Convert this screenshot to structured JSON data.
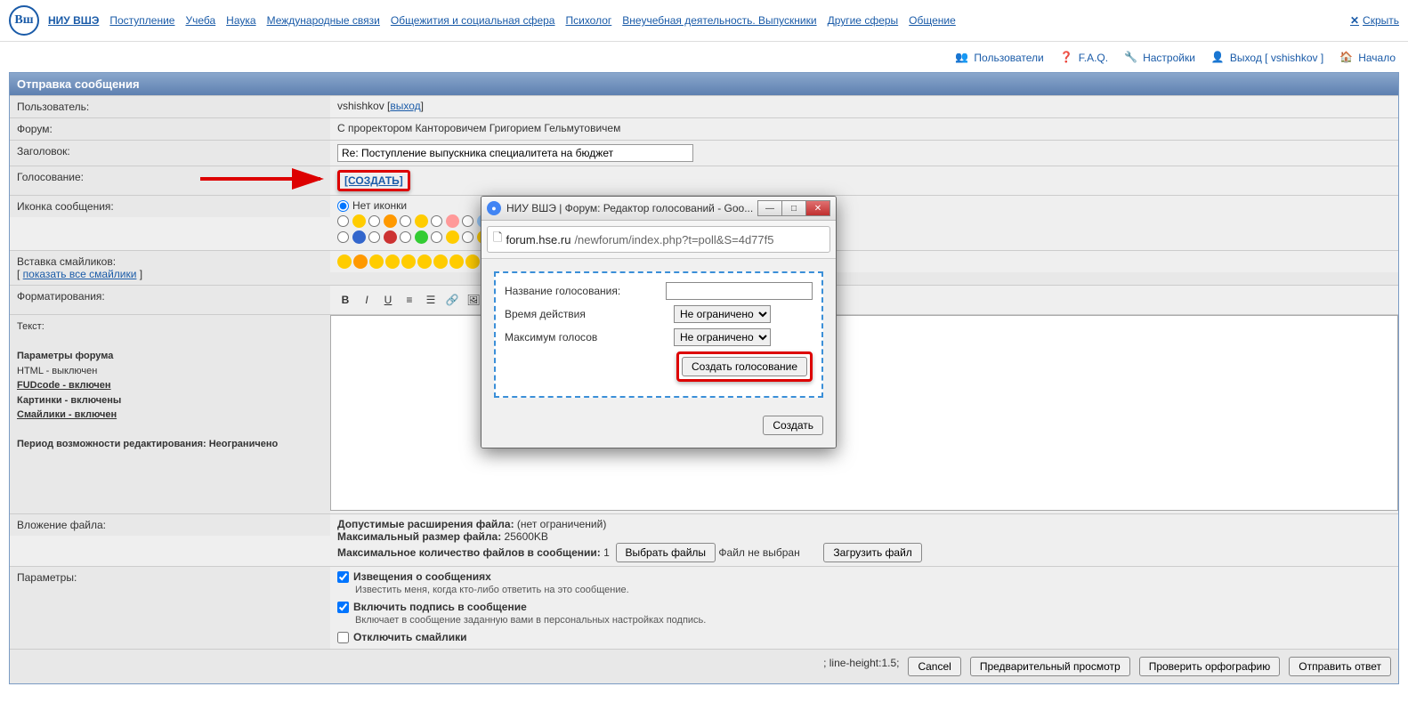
{
  "top_nav": {
    "brand": "НИУ ВШЭ",
    "links": [
      "Поступление",
      "Учеба",
      "Наука",
      "Международные связи",
      "Общежития и социальная сфера",
      "Психолог",
      "Внеучебная деятельность. Выпускники",
      "Другие сферы",
      "Общение"
    ],
    "hide": "Скрыть"
  },
  "util_nav": {
    "users": "Пользователи",
    "faq": "F.A.Q.",
    "settings": "Настройки",
    "logout": "Выход [ vshishkov ]",
    "home": "Начало"
  },
  "section_title": "Отправка сообщения",
  "form": {
    "user_label": "Пользователь:",
    "user_value": "vshishkov",
    "logout_link": "выход",
    "forum_label": "Форум:",
    "forum_value": "С проректором Канторовичем Григорием Гельмутовичем",
    "subject_label": "Заголовок:",
    "subject_value": "Re: Поступление выпускника специалитета на бюджет",
    "poll_label": "Голосование:",
    "poll_create": "[СОЗДАТЬ]",
    "icon_label": "Иконка сообщения:",
    "no_icon": "Нет иконки",
    "smileys_label": "Вставка смайликов:",
    "show_all_smileys": "показать все смайлики",
    "formatting_label": "Форматирования:",
    "text_label": "Текст:",
    "params_heading": "Параметры форума",
    "param_html": "HTML - выключен",
    "param_fud": "FUDcode - включен",
    "param_img": "Картинки - включены",
    "param_sm": "Смайлики - включен",
    "edit_period": "Период возможности редактирования: Неограничено",
    "attach_label": "Вложение файла:",
    "attach_ext_label": "Допустимые расширения файла:",
    "attach_ext_value": "(нет ограничений)",
    "attach_size_label": "Максимальный размер файла:",
    "attach_size_value": "25600KB",
    "attach_count_label": "Максимальное количество файлов в сообщении:",
    "attach_count_value": "1",
    "choose_files": "Выбрать файлы",
    "no_file": "Файл не выбран",
    "upload_btn": "Загрузить файл",
    "options_label": "Параметры:",
    "opt_notify": "Извещения о сообщениях",
    "opt_notify_desc": "Известить меня, когда кто-либо ответить на это сообщение.",
    "opt_sig": "Включить подпись в сообщение",
    "opt_sig_desc": "Включает в сообщение заданную вами в персональных настройках подпись.",
    "opt_nosmileys": "Отключить смайлики"
  },
  "buttons": {
    "cancel": "Cancel",
    "preview": "Предварительный просмотр",
    "spellcheck": "Проверить орфографию",
    "submit": "Отправить ответ"
  },
  "popup": {
    "title": "НИУ ВШЭ | Форум: Редактор голосований - Goo...",
    "url_host": "forum.hse.ru",
    "url_path": "/newforum/index.php?t=poll&S=4d77f5",
    "poll_name_label": "Название голосования:",
    "poll_time_label": "Время действия",
    "poll_time_value": "Не ограничено",
    "poll_max_label": "Максимум голосов",
    "poll_max_value": "Не ограничено",
    "create_poll_btn": "Создать голосование",
    "create_btn": "Создать"
  }
}
